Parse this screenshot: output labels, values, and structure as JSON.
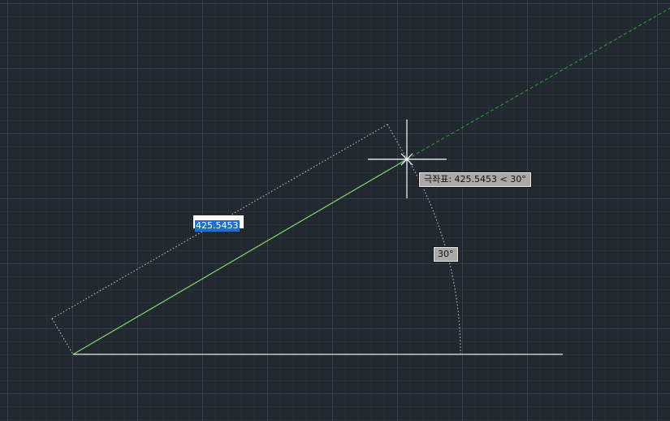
{
  "viewport": {
    "background_color": "#212830"
  },
  "polar_tooltip": {
    "text": "극좌표: 425.5453 < 30°"
  },
  "angle_tooltip": {
    "text": "30°"
  },
  "distance_input": {
    "value": "425.5453"
  },
  "colors": {
    "rubber_band_line": "#7fdc6a",
    "polar_tracking_line": "#2fa52f",
    "base_line": "#c8c8c8",
    "dimension_dots": "#b4b4b4",
    "crosshair": "#ffffff",
    "input_highlight": "#1c6fd1"
  }
}
